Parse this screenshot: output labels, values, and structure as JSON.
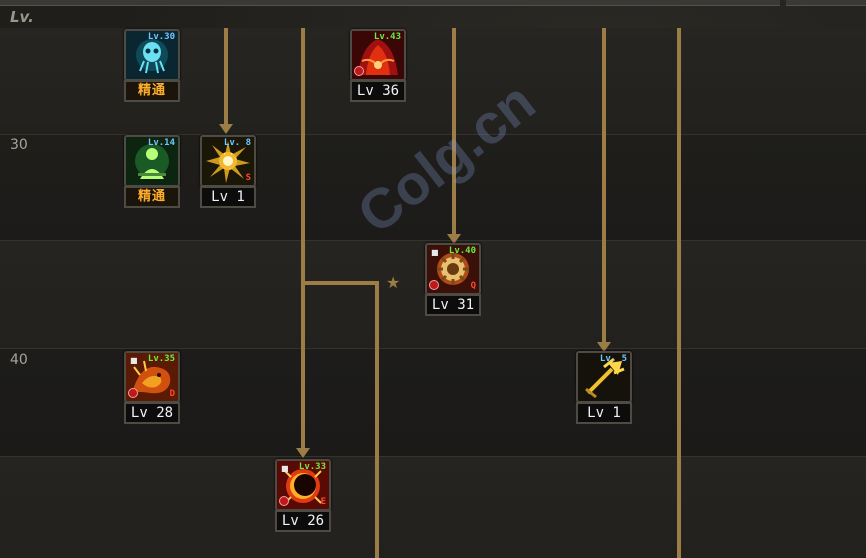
{
  "header": {
    "lv_label": "Lv."
  },
  "rows": [
    "30",
    "40"
  ],
  "watermark": "Colg.cn",
  "colors": {
    "connector": "#9b7d45",
    "mastery_text": "#ffae2a",
    "level_tag_blue": "#6fc6ff",
    "level_tag_green": "#66ee44"
  },
  "skills": [
    {
      "id": "ghost",
      "icon": "blue-ghost-icon",
      "level_tag": "Lv.30",
      "tag_color": "blue",
      "caption": "精通",
      "mastery": true,
      "locked": false
    },
    {
      "id": "silhouette",
      "icon": "green-silhouette-icon",
      "level_tag": "Lv.14",
      "tag_color": "blue",
      "caption": "精通",
      "mastery": true,
      "locked": false
    },
    {
      "id": "burst",
      "icon": "golden-burst-icon",
      "level_tag": "Lv. 8",
      "tag_color": "blue",
      "caption": "Lv 1",
      "hotkey": "S",
      "locked": false
    },
    {
      "id": "red-flame",
      "icon": "red-flame-icon",
      "level_tag": "Lv.43",
      "tag_color": "green",
      "caption": "Lv 36",
      "locked": false
    },
    {
      "id": "cogwheel",
      "icon": "cogwheel-icon",
      "level_tag": "Lv.40",
      "tag_color": "green",
      "caption": "Lv 31",
      "hotkey": "Q",
      "locked": true
    },
    {
      "id": "dragon",
      "icon": "fire-dragon-icon",
      "level_tag": "Lv.35",
      "tag_color": "green",
      "caption": "Lv 28",
      "hotkey": "D",
      "locked": true
    },
    {
      "id": "trident",
      "icon": "golden-trident-icon",
      "level_tag": "Lv. 5",
      "tag_color": "blue",
      "caption": "Lv 1",
      "locked": false
    },
    {
      "id": "eclipse",
      "icon": "eclipse-icon",
      "level_tag": "Lv.33",
      "tag_color": "green",
      "caption": "Lv 26",
      "hotkey": "E",
      "locked": true
    }
  ]
}
